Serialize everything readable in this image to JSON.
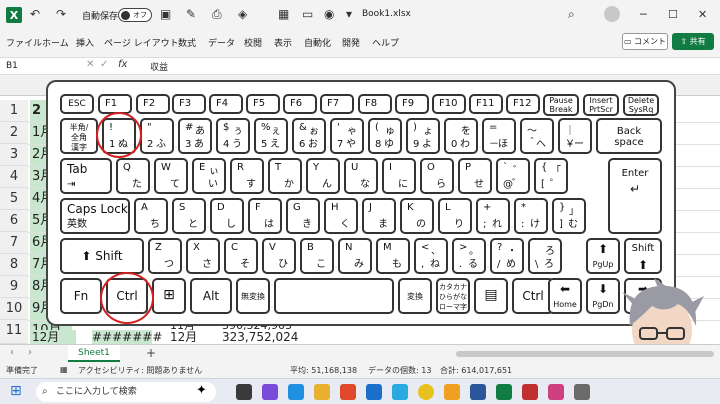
{
  "titlebar": {
    "app_logo": "X",
    "autosave_label": "自動保存",
    "autosave_state": "オフ",
    "filename": "Book1.xlsx"
  },
  "menu": [
    "ファイル",
    "ホーム",
    "挿入",
    "ページ レイアウト",
    "数式",
    "データ",
    "校閲",
    "表示",
    "自動化",
    "開発",
    "ヘルプ"
  ],
  "comment_button": "コメント",
  "share_button": "共有",
  "formula_bar": {
    "name_box": "B1",
    "fx": "fx",
    "value": "収益"
  },
  "sheet": {
    "rows": [
      "1",
      "2",
      "3",
      "4",
      "5",
      "6",
      "7",
      "8",
      "9",
      "10",
      "11",
      "12"
    ],
    "colA": [
      "",
      "2",
      "1月",
      "2月",
      "3月",
      "4月",
      "5月",
      "6月",
      "7月",
      "8月",
      "9月",
      "10月"
    ],
    "row11_b": "11月",
    "row11_c": "390,324,903",
    "row12_a": "12月",
    "row12_b": "#######",
    "row12_c": "12月",
    "row12_d": "323,752,024"
  },
  "keyboard": {
    "row0": [
      "ESC",
      "F1",
      "F2",
      "F3",
      "F4",
      "F5",
      "F6",
      "F7",
      "F8",
      "F9",
      "F10",
      "F11",
      "F12"
    ],
    "pause": [
      "Pause",
      "Break"
    ],
    "insert": [
      "Insert",
      "PrtScr"
    ],
    "delete": [
      "Delete",
      "SysRq"
    ],
    "hankaku": [
      "半角/",
      "全角",
      "漢字"
    ],
    "num_keys": [
      {
        "tl": "!",
        "bl": "1",
        "br": "ぬ"
      },
      {
        "tl": "\"",
        "bl": "2",
        "br": "ふ"
      },
      {
        "tl": "#",
        "tr": "あ",
        "bl": "3",
        "br": "あ"
      },
      {
        "tl": "$",
        "tr": "ぅ",
        "bl": "4",
        "br": "う"
      },
      {
        "tl": "%",
        "tr": "ぇ",
        "bl": "5",
        "br": "え"
      },
      {
        "tl": "&",
        "tr": "ぉ",
        "bl": "6",
        "br": "お"
      },
      {
        "tl": "'",
        "tr": "ゃ",
        "bl": "7",
        "br": "や"
      },
      {
        "tl": "(",
        "tr": "ゅ",
        "bl": "8",
        "br": "ゆ"
      },
      {
        "tl": ")",
        "tr": "ょ",
        "bl": "9",
        "br": "よ"
      },
      {
        "tl": "",
        "tr": "を",
        "bl": "0",
        "br": "わ"
      },
      {
        "tl": "=",
        "bl": "－",
        "br": "ほ"
      },
      {
        "tl": "～",
        "bl": "＾",
        "br": "へ"
      },
      {
        "tl": "｜",
        "bl": "￥",
        "br": "ー"
      }
    ],
    "backspace": [
      "Back",
      "space"
    ],
    "tab": "Tab",
    "qrow": [
      {
        "tl": "Q",
        "br": "た"
      },
      {
        "tl": "W",
        "br": "て"
      },
      {
        "tl": "E",
        "tr": "ぃ",
        "br": "い"
      },
      {
        "tl": "R",
        "br": "す"
      },
      {
        "tl": "T",
        "br": "か"
      },
      {
        "tl": "Y",
        "br": "ん"
      },
      {
        "tl": "U",
        "br": "な"
      },
      {
        "tl": "I",
        "br": "に"
      },
      {
        "tl": "O",
        "br": "ら"
      },
      {
        "tl": "P",
        "br": "せ"
      },
      {
        "tl": "`",
        "tr": "゛",
        "bl": "@",
        "br": "゛"
      },
      {
        "tl": "{",
        "tr": "「",
        "bl": "[",
        "br": "゜"
      }
    ],
    "enter": "Enter",
    "caps": [
      "Caps Lock",
      "英数"
    ],
    "arow": [
      {
        "tl": "A",
        "br": "ち"
      },
      {
        "tl": "S",
        "br": "と"
      },
      {
        "tl": "D",
        "br": "し"
      },
      {
        "tl": "F",
        "br": "は"
      },
      {
        "tl": "G",
        "br": "き"
      },
      {
        "tl": "H",
        "br": "く"
      },
      {
        "tl": "J",
        "br": "ま"
      },
      {
        "tl": "K",
        "br": "の"
      },
      {
        "tl": "L",
        "br": "り"
      },
      {
        "tl": "+",
        "bl": ";",
        "br": "れ"
      },
      {
        "tl": "*",
        "bl": ":",
        "br": "け"
      },
      {
        "tl": "}",
        "tr": "」",
        "bl": "]",
        "br": "む"
      }
    ],
    "shift": "Shift",
    "zrow": [
      {
        "tl": "Z",
        "br": "つ"
      },
      {
        "tl": "X",
        "br": "さ"
      },
      {
        "tl": "C",
        "br": "そ"
      },
      {
        "tl": "V",
        "br": "ひ"
      },
      {
        "tl": "B",
        "br": "こ"
      },
      {
        "tl": "N",
        "br": "み"
      },
      {
        "tl": "M",
        "br": "も"
      },
      {
        "tl": "<",
        "tr": "、",
        "bl": ",",
        "br": "ね"
      },
      {
        "tl": ">",
        "tr": "。",
        "bl": ".",
        "br": "る"
      },
      {
        "tl": "?",
        "tr": "・",
        "bl": "/",
        "br": "め"
      },
      {
        "tl": "",
        "tr": "ろ",
        "bl": "\\",
        "br": "ろ"
      }
    ],
    "pgup": "PgUp",
    "rshift": "Shift",
    "bottom": {
      "fn": "Fn",
      "ctrl": "Ctrl",
      "alt": "Alt",
      "muhenkan": "無変換",
      "henkan": "変換",
      "kana": [
        "カタカナ",
        "ひらがな",
        "ローマ字"
      ],
      "rctrl": "Ctrl",
      "home": "Home",
      "pgdn": "PgDn",
      "end": "End"
    }
  },
  "tabs": {
    "sheet": "Sheet1",
    "add": "+"
  },
  "status": {
    "ready": "準備完了",
    "accessibility": "アクセシビリティ: 問題ありません",
    "avg": "平均: 51,168,138",
    "count": "データの個数: 13",
    "sum": "合計: 614,017,651"
  },
  "taskbar": {
    "search_placeholder": "ここに入力して検索"
  }
}
